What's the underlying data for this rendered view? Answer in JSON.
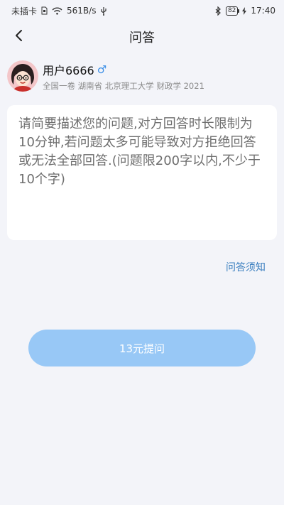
{
  "status_bar": {
    "carrier": "未插卡",
    "speed": "561B/s",
    "battery": "82",
    "time": "17:40"
  },
  "navbar": {
    "title": "问答",
    "back_icon": "chevron-left-icon"
  },
  "user": {
    "name": "用户6666",
    "gender_symbol": "♂",
    "meta": "全国一卷 湖南省 北京理工大学 财政学 2021"
  },
  "question": {
    "placeholder": "请简要描述您的问题,对方回答时长限制为10分钟,若问题太多可能导致对方拒绝回答或无法全部回答.(问题限200字以内,不少于10个字)",
    "value": ""
  },
  "notice_link": "问答须知",
  "submit_button": "13元提问",
  "colors": {
    "background": "#f3f4f9",
    "accent_link": "#3a7ebf",
    "button": "#98c8f6",
    "gender": "#3a8ee6"
  }
}
